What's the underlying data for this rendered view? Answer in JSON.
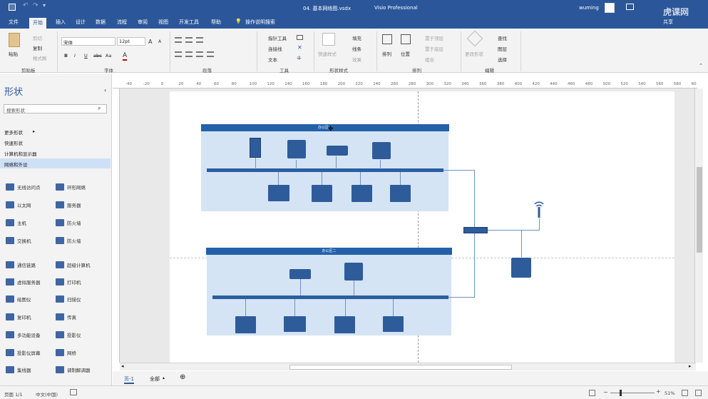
{
  "titlebar": {
    "title": "04. 基本网络图.vsdx",
    "app": "Visio Professional",
    "user": "wuming",
    "watermark": "虎课网"
  },
  "menu": {
    "tabs": [
      "文件",
      "开始",
      "插入",
      "设计",
      "数据",
      "流程",
      "审阅",
      "视图",
      "开发工具",
      "帮助"
    ],
    "active": "开始",
    "tell_me": "操作说明搜索",
    "share": "共享"
  },
  "ribbon": {
    "clipboard": {
      "paste": "粘贴",
      "cut": "剪切",
      "copy": "复制",
      "format_painter": "格式刷",
      "label": "剪贴板"
    },
    "font": {
      "family": "宋体",
      "size": "12pt",
      "bold": "B",
      "italic": "I",
      "underline": "U",
      "strike": "abc",
      "case": "Aa",
      "color": "A",
      "grow": "A",
      "shrink": "A",
      "label": "字体"
    },
    "paragraph": {
      "label": "段落"
    },
    "tools": {
      "pointer": "指针工具",
      "connector": "连接线",
      "text": "文本",
      "label": "工具"
    },
    "shape_styles": {
      "quick_styles": "快速样式",
      "fill": "填充",
      "line": "线条",
      "effects": "效果",
      "label": "形状样式"
    },
    "arrange": {
      "align": "排列",
      "position": "位置",
      "bring_front": "置于顶层",
      "send_back": "置于底层",
      "group": "组合",
      "label": "排列"
    },
    "editing": {
      "change_shape": "更改形状",
      "find": "查找",
      "layers": "图层",
      "select": "选择",
      "label": "编辑"
    }
  },
  "shapes_panel": {
    "title": "形状",
    "search_placeholder": "搜索形状",
    "sections": [
      "更多形状",
      "快速形状",
      "计算机和显示器",
      "网络和外设"
    ],
    "selected_section": "网络和外设",
    "items": [
      "无线访问点",
      "环形网络",
      "以太网",
      "服务器",
      "主机",
      "防火墙",
      "交换机",
      "防火墙",
      "通信链路",
      "超级计算机",
      "虚拟服务器",
      "打印机",
      "绘图仪",
      "扫描仪",
      "复印机",
      "传真",
      "多功能设备",
      "投影仪",
      "投影仪屏幕",
      "网桥",
      "集线器",
      "调制解调器"
    ]
  },
  "diagram": {
    "office1_title": "办公区一",
    "office2_title": "办公区二",
    "colors": {
      "band": "#2461a9",
      "region": "#d5e4f5",
      "bus": "#2b5ea1",
      "device": "#2e5c9a"
    }
  },
  "ruler_ticks": [
    "-40",
    "-20",
    "0",
    "20",
    "40",
    "60",
    "80",
    "100",
    "120",
    "140",
    "160",
    "180",
    "200",
    "220",
    "240",
    "260",
    "280",
    "300",
    "320",
    "340",
    "360",
    "380",
    "400",
    "420",
    "440",
    "460",
    "480",
    "500",
    "520",
    "540",
    "560",
    "580",
    "60"
  ],
  "page_tabs": {
    "current": "页-1",
    "all": "全部"
  },
  "statusbar": {
    "page": "页面 1/1",
    "language": "中文(中国)",
    "zoom": "51%"
  }
}
